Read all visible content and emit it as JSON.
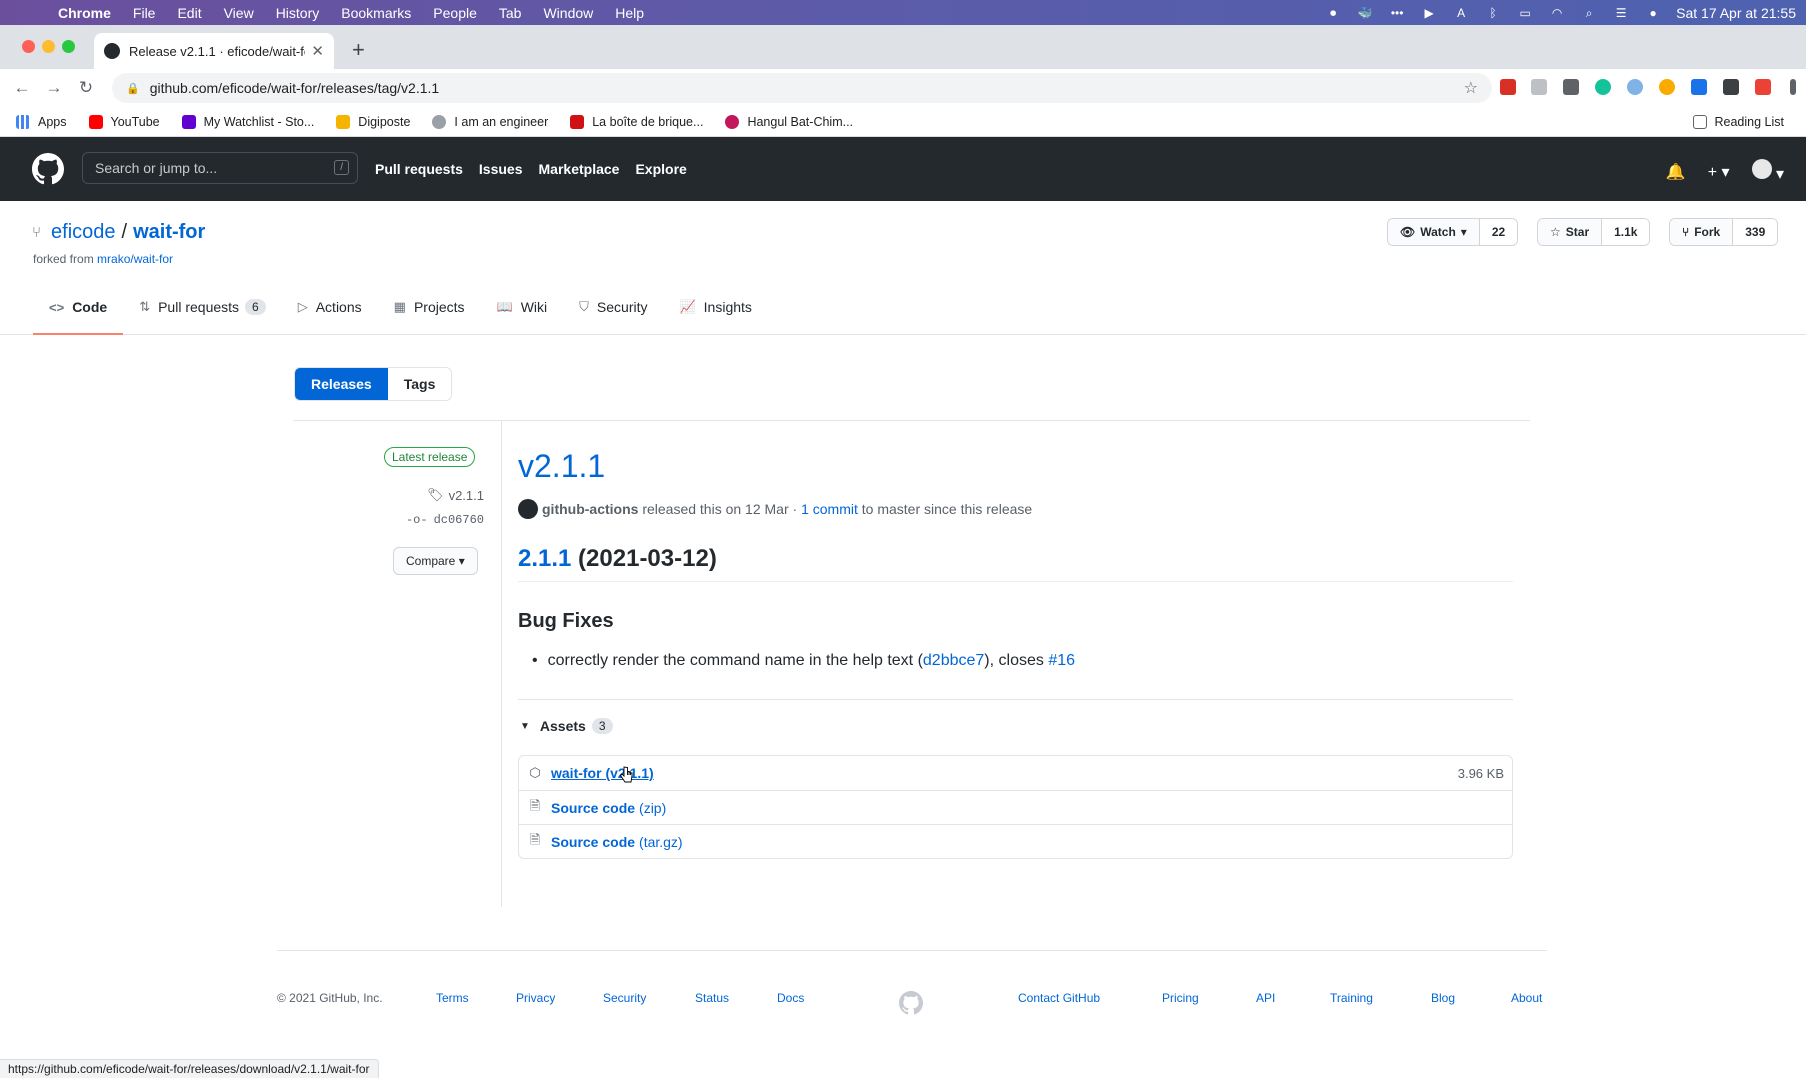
{
  "macos": {
    "app": "Chrome",
    "menus": [
      "File",
      "Edit",
      "View",
      "History",
      "Bookmarks",
      "People",
      "Tab",
      "Window",
      "Help"
    ],
    "clock": "Sat 17 Apr at  21:55"
  },
  "browser": {
    "tab_title": "Release v2.1.1 · eficode/wait-fo",
    "url": "github.com/eficode/wait-for/releases/tag/v2.1.1",
    "bookmarks": [
      "Apps",
      "YouTube",
      "My Watchlist - Sto...",
      "Digiposte",
      "I am an engineer",
      "La boîte de brique...",
      "Hangul Bat-Chim..."
    ],
    "reading_list": "Reading List",
    "status_url": "https://github.com/eficode/wait-for/releases/download/v2.1.1/wait-for"
  },
  "github": {
    "search_placeholder": "Search or jump to...",
    "search_key": "/",
    "nav": [
      "Pull requests",
      "Issues",
      "Marketplace",
      "Explore"
    ]
  },
  "repo": {
    "owner": "eficode",
    "name": "wait-for",
    "forked_prefix": "forked from ",
    "forked_from": "mrako/wait-for",
    "watch_label": "Watch",
    "watch_count": "22",
    "star_label": "Star",
    "star_count": "1.1k",
    "fork_label": "Fork",
    "fork_count": "339",
    "tabs": {
      "code": "Code",
      "pulls": "Pull requests",
      "pulls_count": "6",
      "actions": "Actions",
      "projects": "Projects",
      "wiki": "Wiki",
      "security": "Security",
      "insights": "Insights"
    }
  },
  "releases": {
    "toggle_releases": "Releases",
    "toggle_tags": "Tags",
    "latest_badge": "Latest release",
    "tag": "v2.1.1",
    "commit": "dc06760",
    "compare": "Compare",
    "title": "v2.1.1",
    "author": "github-actions",
    "released_text": " released this on 12 Mar · ",
    "commits_link": "1 commit",
    "since_text": " to master since this release",
    "heading_version": "2.1.1",
    "heading_date": " (2021-03-12)",
    "bug_fixes_heading": "Bug Fixes",
    "bullet_text": "correctly render the command name in the help text (",
    "bullet_commit": "d2bbce7",
    "bullet_mid": "), closes ",
    "bullet_issue": "#16",
    "assets_label": "Assets",
    "assets_count": "3",
    "assets": [
      {
        "name": "wait-for (v2.1.1)",
        "size": "3.96 KB"
      },
      {
        "name": "Source code",
        "suffix": "(zip)"
      },
      {
        "name": "Source code",
        "suffix": "(tar.gz)"
      }
    ]
  },
  "footer": {
    "copyright": "© 2021 GitHub, Inc.",
    "links_left": [
      "Terms",
      "Privacy",
      "Security",
      "Status",
      "Docs"
    ],
    "links_right": [
      "Contact GitHub",
      "Pricing",
      "API",
      "Training",
      "Blog",
      "About"
    ]
  }
}
